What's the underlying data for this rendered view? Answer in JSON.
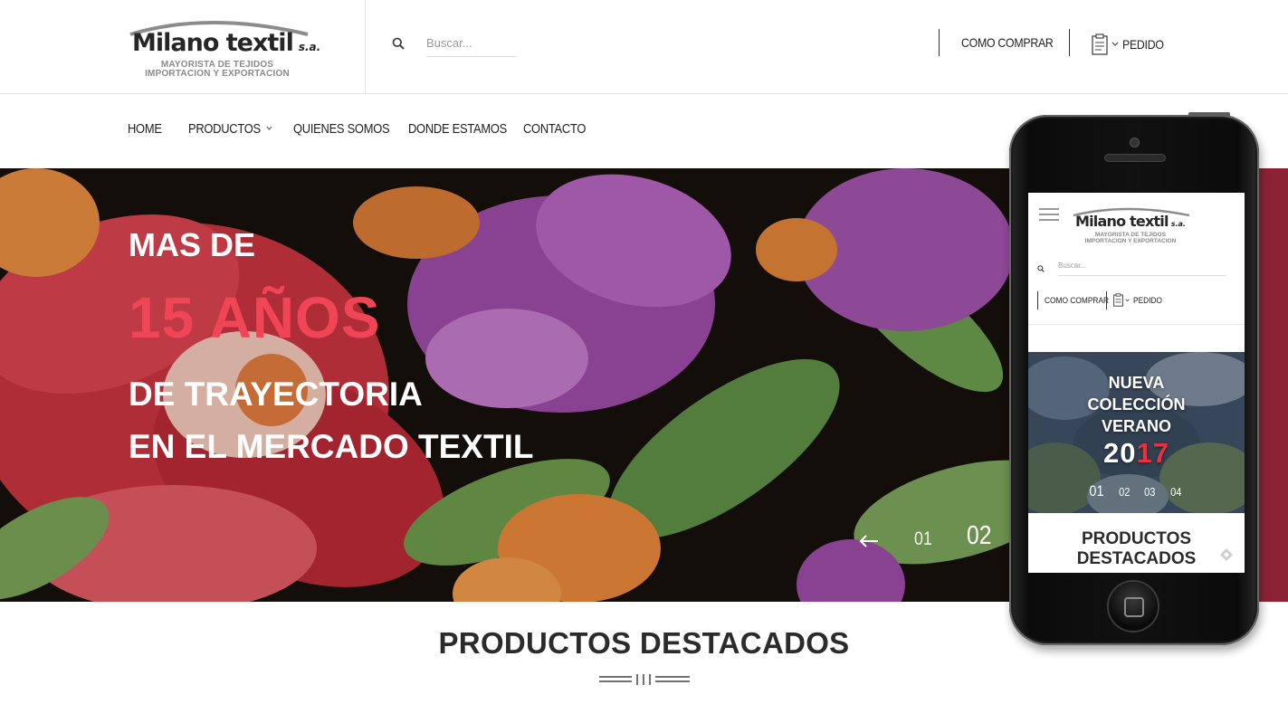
{
  "brand": {
    "name": "Milano textil",
    "suffix": "s.a.",
    "tagline_1": "MAYORISTA DE TEJIDOS",
    "tagline_2": "IMPORTACION Y EXPORTACION"
  },
  "header": {
    "search": {
      "placeholder": "Buscar...",
      "icon": "search-icon"
    },
    "how_to_buy": "COMO COMPRAR",
    "order": {
      "label": "PEDIDO",
      "icon": "clipboard-icon"
    }
  },
  "nav": {
    "items": [
      {
        "label": "HOME"
      },
      {
        "label": "PRODUCTOS",
        "has_dropdown": true
      },
      {
        "label": "QUIENES SOMOS"
      },
      {
        "label": "DONDE ESTAMOS"
      },
      {
        "label": "CONTACTO"
      }
    ]
  },
  "hero": {
    "line_1": "MAS DE",
    "line_2": "15 AÑOS",
    "line_3": "DE TRAYECTORIA",
    "line_4": "EN EL MERCADO TEXTIL",
    "accent_color": "#f04457",
    "pager": {
      "prev_icon": "arrow-left-icon",
      "pages": [
        "01",
        "02"
      ],
      "active": "02"
    }
  },
  "featured": {
    "title": "PRODUCTOS DESTACADOS"
  },
  "mobile_preview": {
    "menu_icon": "hamburger-icon",
    "search_placeholder": "Buscar...",
    "how_to_buy": "COMO COMPRAR",
    "order_label": "PEDIDO",
    "banner": {
      "line_1": "NUEVA",
      "line_2": "COLECCIÓN",
      "line_3": "VERANO",
      "year_a": "20",
      "year_b": "17",
      "pages": [
        "01",
        "02",
        "03",
        "04"
      ]
    },
    "section_title_1": "PRODUCTOS",
    "section_title_2": "DESTACADOS"
  }
}
